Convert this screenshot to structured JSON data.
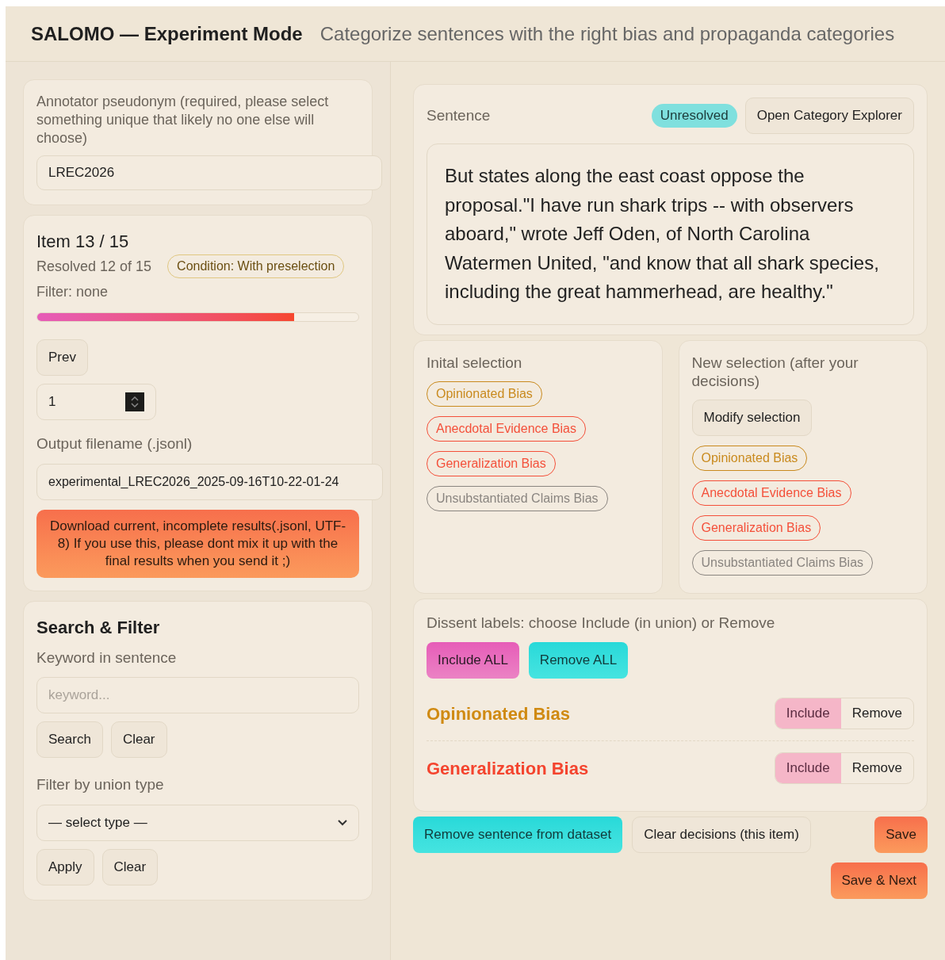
{
  "header": {
    "title": "SALOMO — Experiment Mode",
    "subtitle": "Categorize sentences with the right bias and propaganda categories"
  },
  "annotator": {
    "label": "Annotator pseudonym (required, please select something unique that likely no one else will choose)",
    "value": "LREC2026"
  },
  "progress": {
    "item": "Item 13 / 15",
    "resolved": "Resolved 12 of 15",
    "condition": "Condition: With preselection",
    "filter": "Filter: none",
    "level": 0.8,
    "prev_button": "Prev",
    "jump_value": "1",
    "output_label": "Output filename (.jsonl)",
    "output_value": "experimental_LREC2026_2025-09-16T10-22-01-24",
    "download_button": "Download current, incomplete results(.jsonl, UTF-8) If you use this, please dont mix it up with the final results when you send it ;)"
  },
  "search_filter": {
    "title": "Search & Filter",
    "keyword_label": "Keyword in sentence",
    "keyword_placeholder": "keyword...",
    "search_button": "Search",
    "clear_button": "Clear",
    "union_label": "Filter by union type",
    "union_select": "— select type —",
    "apply_button": "Apply",
    "clear_button_2": "Clear"
  },
  "sentence": {
    "label": "Sentence",
    "status": "Unresolved",
    "explorer_button": "Open Category Explorer",
    "text": "But states along the east coast oppose the proposal.\"I have run shark trips -- with observers aboard,\" wrote Jeff Oden, of North Carolina Watermen United, \"and know that all shark species, including the great hammerhead, are healthy.\""
  },
  "initial_selection": {
    "title": "Inital selection",
    "tags": [
      {
        "label": "Opinionated Bias",
        "color": "#c98a1e"
      },
      {
        "label": "Anecdotal Evidence Bias",
        "color": "#f4503a"
      },
      {
        "label": "Generalization Bias",
        "color": "#f4503a"
      },
      {
        "label": "Unsubstantiated Claims Bias",
        "color": "#8a8580"
      }
    ]
  },
  "new_selection": {
    "title": "New selection (after your decisions)",
    "modify_button": "Modify selection",
    "tags": [
      {
        "label": "Opinionated Bias",
        "color": "#c98a1e"
      },
      {
        "label": "Anecdotal Evidence Bias",
        "color": "#f4503a"
      },
      {
        "label": "Generalization Bias",
        "color": "#f4503a"
      },
      {
        "label": "Unsubstantiated Claims Bias",
        "color": "#8a8580"
      }
    ]
  },
  "dissent": {
    "title": "Dissent labels: choose Include (in union) or Remove",
    "include_all": "Include ALL",
    "remove_all": "Remove ALL",
    "rows": [
      {
        "label": "Opinionated Bias",
        "color": "#d08a12",
        "options": [
          {
            "label": "Include",
            "selected": true
          },
          {
            "label": "Remove",
            "selected": false
          }
        ]
      },
      {
        "label": "Generalization Bias",
        "color": "#f4442e",
        "options": [
          {
            "label": "Include",
            "selected": true
          },
          {
            "label": "Remove",
            "selected": false
          }
        ]
      }
    ]
  },
  "actions": {
    "remove_sentence": "Remove sentence from dataset",
    "clear_decisions": "Clear decisions (this item)",
    "save": "Save",
    "save_next": "Save & Next"
  }
}
